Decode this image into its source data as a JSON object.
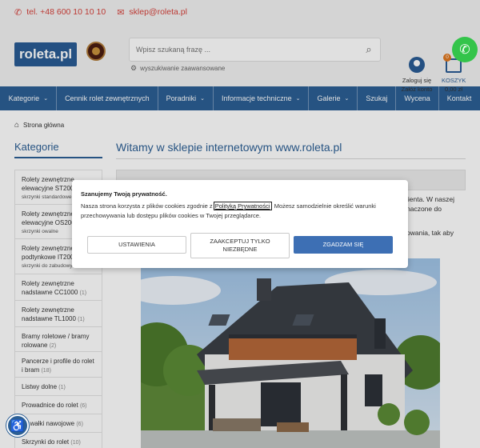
{
  "topbar": {
    "phone": "tel. +48 600 10 10 10",
    "email": "sklep@roleta.pl"
  },
  "header": {
    "logo": "roleta.pl",
    "search_placeholder": "Wpisz szukaną frazę ...",
    "advanced_search": "wyszukiwanie zaawansowane",
    "account_line1": "Zaloguj się",
    "account_line2": "Załóż konto",
    "cart_count": "0",
    "cart_label": "KOSZYK",
    "cart_total": "0,00 zł"
  },
  "nav": {
    "items": [
      "Kategorie",
      "Cennik rolet zewnętrznych",
      "Poradniki",
      "Informacje techniczne",
      "Galerie",
      "Szukaj",
      "Wycena",
      "Kontakt"
    ]
  },
  "breadcrumb": "Strona główna",
  "sidebar": {
    "title": "Kategorie",
    "categories": [
      {
        "name": "Rolety zewnętrzne elewacyjne ST200",
        "sub": "skrzynki standardowe"
      },
      {
        "name": "Rolety zewnętrzne elewacyjne OS200",
        "sub": "skrzynki owalne"
      },
      {
        "name": "Rolety zewnętrzne podtynkowe IT200",
        "sub": "skrzynki do zabudowy"
      },
      {
        "name": "Rolety zewnętrzne nadstawne CC1000",
        "count": "(1)"
      },
      {
        "name": "Rolety zewnętrzne nadstawne TL1000",
        "count": "(1)"
      },
      {
        "name": "Bramy roletowe / bramy rolowane",
        "count": "(2)"
      },
      {
        "name": "Pancerze i profile do rolet i bram",
        "count": "(18)"
      },
      {
        "name": "Listwy dolne",
        "count": "(1)"
      },
      {
        "name": "Prowadnice do rolet",
        "count": "(6)"
      },
      {
        "name": "ry, wałki nawojowe",
        "count": "(6)"
      },
      {
        "name": "Skrzynki do rolet",
        "count": "(10)"
      }
    ]
  },
  "main": {
    "title": "Witamy w sklepie internetowym www.roleta.pl",
    "text_line1": "lienta. W naszej",
    "text_line2": "naczone do",
    "text_line3": "",
    "text_line4": "owania, tak aby"
  },
  "cookie": {
    "title": "Szanujemy Twoją prywatność.",
    "text_before": "Nasza strona korzysta z plików cookies zgodnie z ",
    "policy_link": "Polityką Prywatności",
    "text_after": ". Możesz samodzielnie określić warunki przechowywania lub dostępu plików cookies w Twojej przeglądarce.",
    "btn_settings": "USTAWIENIA",
    "btn_necessary": "ZAAKCEPTUJ TYLKO NIEZBĘDNE",
    "btn_accept": "ZGADZAM SIĘ"
  },
  "icons": {
    "phone": "phone-icon",
    "email": "envelope-icon",
    "search": "search-icon",
    "user": "user-icon",
    "cart": "cart-icon",
    "home": "home-icon",
    "accessibility": "accessibility-icon",
    "call_fab": "phone-call-icon"
  },
  "colors": {
    "brand_blue": "#2c5f95",
    "accent_red": "#d6413b",
    "accept_button": "#3d6fb4",
    "call_green": "#33c44a",
    "cart_badge": "#e07820"
  }
}
